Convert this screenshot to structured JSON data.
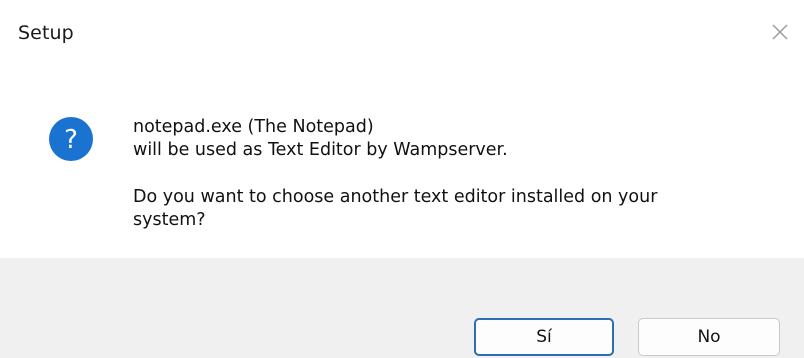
{
  "window": {
    "title": "Setup"
  },
  "icons": {
    "close": "close-icon",
    "question": "question-icon"
  },
  "colors": {
    "accent": "#1b73d1",
    "default_button_border": "#2c6db3",
    "footer_bg": "#f0f0f0"
  },
  "message": {
    "line1": "notepad.exe (The Notepad)",
    "line2": "will be used as Text Editor by Wampserver.",
    "question_line1": "Do you want to choose another text editor installed on your",
    "question_line2": "system?"
  },
  "buttons": {
    "yes_label": "Sí",
    "no_label": "No"
  }
}
